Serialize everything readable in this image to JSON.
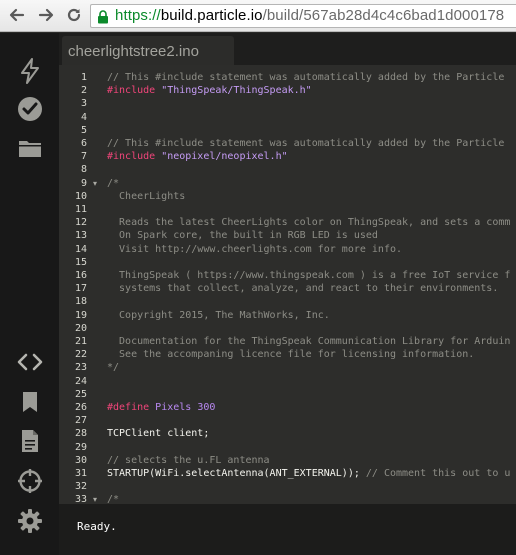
{
  "browser": {
    "back_icon": "arrow-left-icon",
    "forward_icon": "arrow-right-icon",
    "reload_icon": "reload-icon",
    "url_scheme": "https://",
    "url_host": "build.particle.io",
    "url_path": "/build/567ab28d4c4c6bad1d000178"
  },
  "sidebar": {
    "items": [
      {
        "name": "flash-icon"
      },
      {
        "name": "verify-icon"
      },
      {
        "name": "files-icon"
      },
      {
        "name": "code-icon"
      },
      {
        "name": "libraries-icon"
      },
      {
        "name": "docs-icon"
      },
      {
        "name": "devices-icon"
      },
      {
        "name": "settings-icon"
      }
    ]
  },
  "editor": {
    "tab_label": "cheerlightstree2.ino",
    "lines": [
      {
        "n": "1",
        "fold": "",
        "parts": [
          {
            "c": "t-comment",
            "t": "// This #include statement was automatically added by the Particle"
          }
        ]
      },
      {
        "n": "2",
        "fold": "",
        "parts": [
          {
            "c": "t-pre",
            "t": "#include "
          },
          {
            "c": "t-str2",
            "t": "\"ThingSpeak/ThingSpeak.h\""
          }
        ]
      },
      {
        "n": "3",
        "fold": "",
        "parts": []
      },
      {
        "n": "4",
        "fold": "",
        "parts": []
      },
      {
        "n": "5",
        "fold": "",
        "parts": []
      },
      {
        "n": "6",
        "fold": "",
        "parts": [
          {
            "c": "t-comment",
            "t": "// This #include statement was automatically added by the Particle"
          }
        ]
      },
      {
        "n": "7",
        "fold": "",
        "parts": [
          {
            "c": "t-pre",
            "t": "#include "
          },
          {
            "c": "t-str2",
            "t": "\"neopixel/neopixel.h\""
          }
        ]
      },
      {
        "n": "8",
        "fold": "",
        "parts": []
      },
      {
        "n": "9",
        "fold": "▾",
        "parts": [
          {
            "c": "t-comment",
            "t": "/*"
          }
        ]
      },
      {
        "n": "10",
        "fold": "",
        "parts": [
          {
            "c": "t-comment",
            "t": "  CheerLights"
          }
        ]
      },
      {
        "n": "11",
        "fold": "",
        "parts": []
      },
      {
        "n": "12",
        "fold": "",
        "parts": [
          {
            "c": "t-comment",
            "t": "  Reads the latest CheerLights color on ThingSpeak, and sets a comm"
          }
        ]
      },
      {
        "n": "13",
        "fold": "",
        "parts": [
          {
            "c": "t-comment",
            "t": "  On Spark core, the built in RGB LED is used"
          }
        ]
      },
      {
        "n": "14",
        "fold": "",
        "parts": [
          {
            "c": "t-comment",
            "t": "  Visit http://www.cheerlights.com for more info."
          }
        ]
      },
      {
        "n": "15",
        "fold": "",
        "parts": []
      },
      {
        "n": "16",
        "fold": "",
        "parts": [
          {
            "c": "t-comment",
            "t": "  ThingSpeak ( https://www.thingspeak.com ) is a free IoT service f"
          }
        ]
      },
      {
        "n": "17",
        "fold": "",
        "parts": [
          {
            "c": "t-comment",
            "t": "  systems that collect, analyze, and react to their environments."
          }
        ]
      },
      {
        "n": "18",
        "fold": "",
        "parts": []
      },
      {
        "n": "19",
        "fold": "",
        "parts": [
          {
            "c": "t-comment",
            "t": "  Copyright 2015, The MathWorks, Inc."
          }
        ]
      },
      {
        "n": "20",
        "fold": "",
        "parts": []
      },
      {
        "n": "21",
        "fold": "",
        "parts": [
          {
            "c": "t-comment",
            "t": "  Documentation for the ThingSpeak Communication Library for Arduin"
          }
        ]
      },
      {
        "n": "22",
        "fold": "",
        "parts": [
          {
            "c": "t-comment",
            "t": "  See the accompaning licence file for licensing information."
          }
        ]
      },
      {
        "n": "23",
        "fold": "",
        "parts": [
          {
            "c": "t-comment",
            "t": "*/"
          }
        ]
      },
      {
        "n": "24",
        "fold": "",
        "parts": []
      },
      {
        "n": "25",
        "fold": "",
        "parts": []
      },
      {
        "n": "26",
        "fold": "",
        "parts": [
          {
            "c": "t-pre",
            "t": "#define "
          },
          {
            "c": "t-const",
            "t": "Pixels 300"
          }
        ]
      },
      {
        "n": "27",
        "fold": "",
        "parts": []
      },
      {
        "n": "28",
        "fold": "",
        "parts": [
          {
            "c": "t-plain",
            "t": "TCPClient client;"
          }
        ]
      },
      {
        "n": "29",
        "fold": "",
        "parts": []
      },
      {
        "n": "30",
        "fold": "",
        "parts": [
          {
            "c": "t-comment",
            "t": "// selects the u.FL antenna"
          }
        ]
      },
      {
        "n": "31",
        "fold": "",
        "parts": [
          {
            "c": "t-plain",
            "t": "STARTUP(WiFi.selectAntenna(ANT_EXTERNAL)); "
          },
          {
            "c": "t-comment",
            "t": "// Comment this out to u"
          }
        ]
      },
      {
        "n": "32",
        "fold": "",
        "parts": []
      },
      {
        "n": "33",
        "fold": "▾",
        "parts": [
          {
            "c": "t-comment",
            "t": "/*"
          }
        ]
      }
    ]
  },
  "status": {
    "text": "Ready."
  }
}
